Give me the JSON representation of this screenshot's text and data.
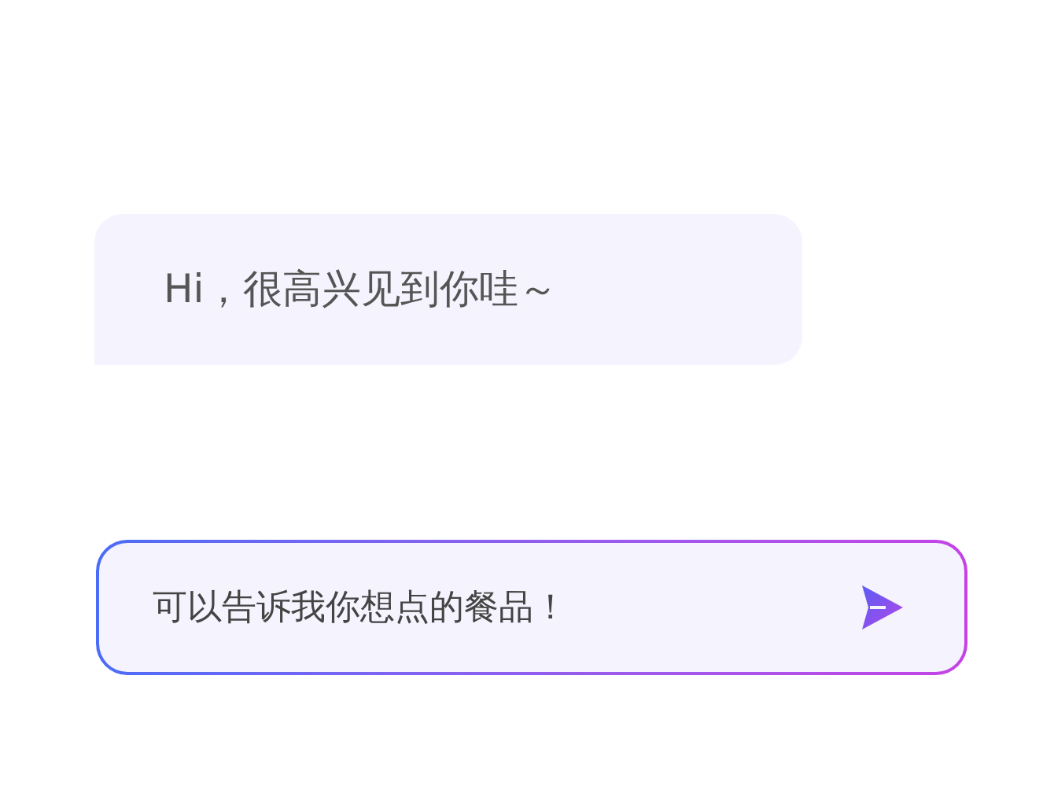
{
  "message": {
    "text": "Hi，很高兴见到你哇～"
  },
  "input": {
    "placeholder": "可以告诉我你想点的餐品！"
  }
}
